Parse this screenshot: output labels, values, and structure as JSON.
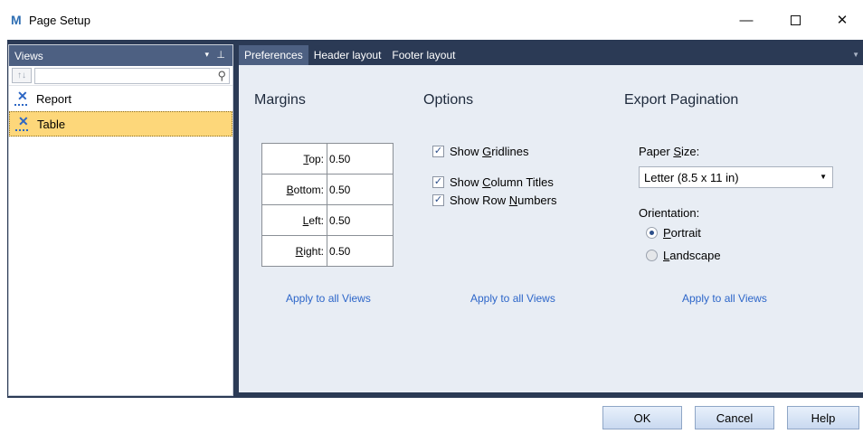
{
  "window": {
    "app_icon": "M",
    "title": "Page Setup",
    "minimize": "—",
    "close": "✕"
  },
  "views_panel": {
    "title": "Views",
    "dropdown_glyph": "▾",
    "pin_glyph": "📌",
    "sort_glyph": "↑↓",
    "search_placeholder": "",
    "items": [
      {
        "label": "Report",
        "icon": "report-view-icon",
        "selected": false
      },
      {
        "label": "Table",
        "icon": "table-view-icon",
        "selected": true
      }
    ]
  },
  "tabs": [
    {
      "label": "Preferences",
      "active": true
    },
    {
      "label": "Header layout",
      "active": false
    },
    {
      "label": "Footer layout",
      "active": false
    }
  ],
  "margins": {
    "title": "Margins",
    "rows": [
      {
        "label": "Top:",
        "value": "0.50"
      },
      {
        "label": "Bottom:",
        "value": "0.50"
      },
      {
        "label": "Left:",
        "value": "0.50"
      },
      {
        "label": "Right:",
        "value": "0.50"
      }
    ],
    "apply_link": "Apply to all Views"
  },
  "options": {
    "title": "Options",
    "checkboxes": [
      {
        "label": "Show Gridlines",
        "checked": true
      },
      {
        "label": "Show Column Titles",
        "checked": true
      },
      {
        "label": "Show Row Numbers",
        "checked": true
      }
    ],
    "apply_link": "Apply to all Views"
  },
  "export_pagination": {
    "title": "Export Pagination",
    "paper_size_label": "Paper Size:",
    "paper_size_value": "Letter (8.5 x 11 in)",
    "orientation_label": "Orientation:",
    "orientations": [
      {
        "label": "Portrait",
        "selected": true
      },
      {
        "label": "Landscape",
        "selected": false
      }
    ],
    "apply_link": "Apply to all Views"
  },
  "buttons": {
    "ok": "OK",
    "cancel": "Cancel",
    "help": "Help"
  },
  "colors": {
    "frame": "#2b3a55",
    "header": "#4d6082",
    "content_bg": "#e8edf4",
    "selected_item": "#fdd77a",
    "link": "#2d66c9"
  }
}
